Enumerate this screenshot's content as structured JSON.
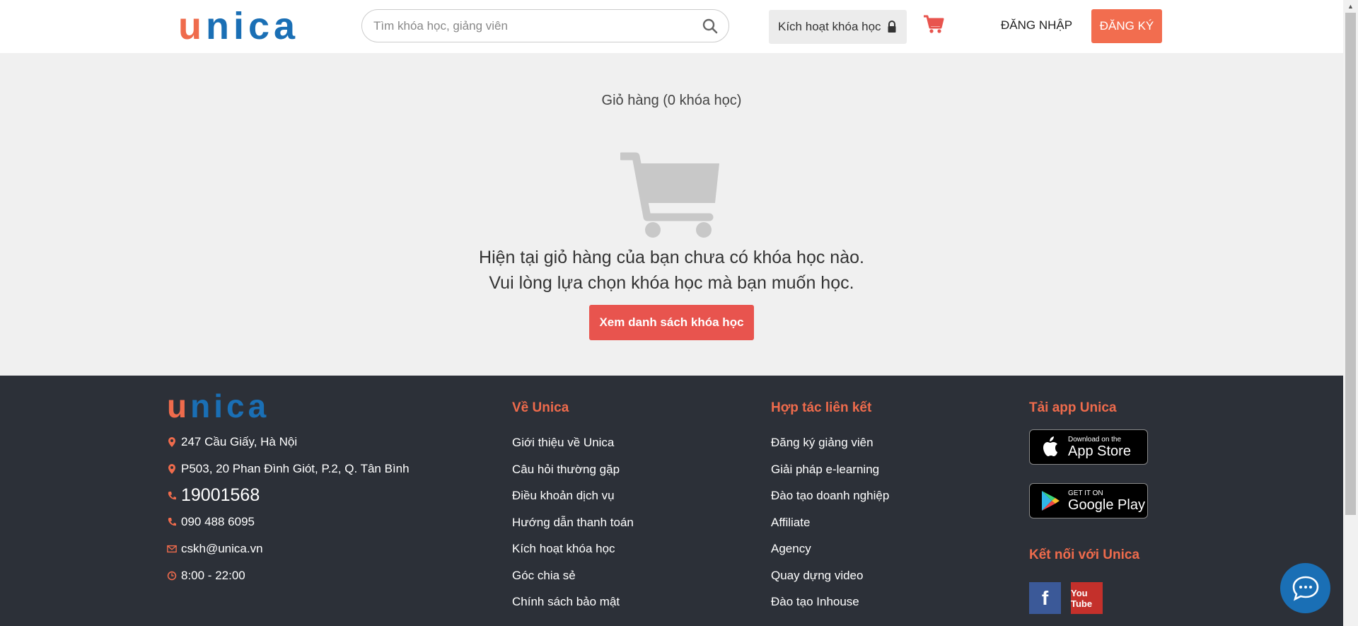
{
  "header": {
    "logo_u": "u",
    "logo_rest": "nica",
    "search_placeholder": "Tìm khóa học, giảng viên",
    "activate_label": "Kích hoạt khóa học",
    "login_label": "ĐĂNG NHẬP",
    "signup_label": "ĐĂNG KÝ"
  },
  "main": {
    "cart_title": "Giỏ hàng (0 khóa học)",
    "empty_line1": "Hiện tại giỏ hàng của bạn chưa có khóa học nào.",
    "empty_line2": "Vui lòng lựa chọn khóa học mà bạn muốn học.",
    "browse_button": "Xem danh sách khóa học"
  },
  "footer": {
    "logo_u": "u",
    "logo_rest": "nica",
    "contact": {
      "address1": "247 Cầu Giấy, Hà Nội",
      "address2": "P503, 20 Phan Đình Giót, P.2, Q. Tân Bình",
      "hotline": "19001568",
      "phone": "090 488 6095",
      "email": "cskh@unica.vn",
      "hours": "8:00 - 22:00"
    },
    "about": {
      "title": "Về Unica",
      "links": [
        "Giới thiệu về Unica",
        "Câu hỏi thường gặp",
        "Điều khoản dịch vụ",
        "Hướng dẫn thanh toán",
        "Kích hoạt khóa học",
        "Góc chia sẻ",
        "Chính sách bảo mật"
      ]
    },
    "partner": {
      "title": "Hợp tác liên kết",
      "links": [
        "Đăng ký giảng viên",
        "Giải pháp e-learning",
        "Đào tạo doanh nghiệp",
        "Affiliate",
        "Agency",
        "Quay dựng video",
        "Đào tạo Inhouse"
      ]
    },
    "app": {
      "title": "Tải app Unica",
      "appstore_small": "Download on the",
      "appstore_big": "App Store",
      "googleplay_small": "GET IT ON",
      "googleplay_big": "Google Play"
    },
    "connect": {
      "title": "Kết nối với Unica",
      "facebook": "f",
      "youtube": "You Tube"
    }
  },
  "colors": {
    "accent": "#ef6b4c",
    "brand_blue": "#1a6fb5",
    "button_red": "#e8544e",
    "footer_bg": "#2c3038"
  }
}
